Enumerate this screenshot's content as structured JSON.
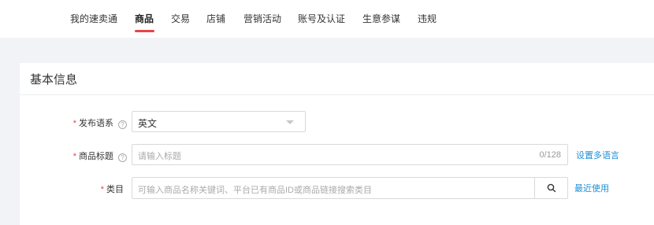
{
  "nav": {
    "items": [
      "我的速卖通",
      "商品",
      "交易",
      "店铺",
      "营销活动",
      "账号及认证",
      "生意参谋",
      "违规"
    ],
    "active_index": 1
  },
  "section": {
    "title": "基本信息"
  },
  "form": {
    "language": {
      "label": "发布语系",
      "value": "英文"
    },
    "title": {
      "label": "商品标题",
      "placeholder": "请输入标题",
      "counter": "0/128",
      "link": "设置多语言"
    },
    "category": {
      "label": "类目",
      "placeholder": "可输入商品名称关键词、平台已有商品ID或商品链接搜索类目",
      "link": "最近使用"
    },
    "required_mark": "*",
    "help_mark": "?"
  },
  "colors": {
    "accent": "#e8434a",
    "link": "#1d8fd6"
  }
}
